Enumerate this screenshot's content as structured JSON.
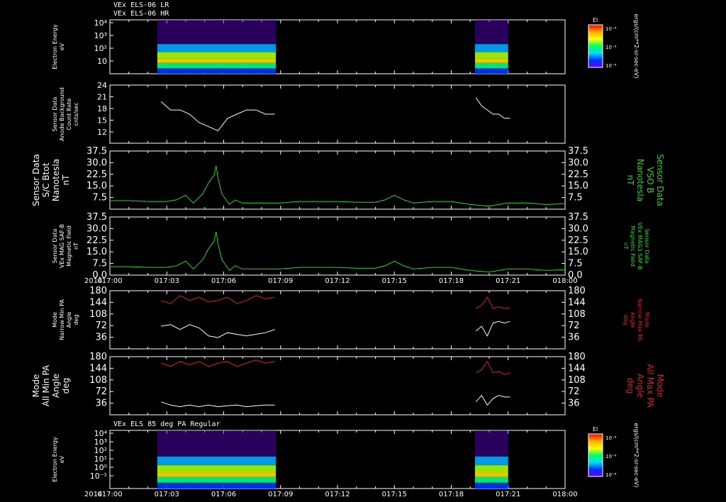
{
  "header": {
    "line1": "VEx ELS-06 LR",
    "line2": "VEx ELS-06 HR",
    "panel7_title": "VEx ELS 85 deg PA Regular"
  },
  "colors": {
    "bg": "#000000",
    "axis": "#ffffff",
    "green": "#22dd22",
    "red": "#dd2222",
    "white": "#ffffff"
  },
  "time_axis": {
    "labels": [
      "017:00",
      "017:03",
      "017:06",
      "017:09",
      "017:12",
      "017:15",
      "017:18",
      "017:21",
      "018:00"
    ],
    "year_label": "2014"
  },
  "colorbar": {
    "title": "El",
    "unit_label": "ergs/(cm**2-sr-sec-eV)",
    "ticks": [
      "10⁻⁴",
      "10⁻⁶",
      "10⁻⁸"
    ]
  },
  "chart_data": [
    {
      "id": "p1",
      "type": "heatmap",
      "ylabel": [
        "Electron Energy",
        "eV"
      ],
      "yticks_left": [
        "10⁴",
        "10³",
        "10²",
        "10"
      ],
      "scale": "log",
      "coverage": [
        [
          "017:02:30",
          "017:08:45"
        ],
        [
          "017:19:15",
          "017:21:00"
        ]
      ]
    },
    {
      "id": "p2",
      "type": "line",
      "ylabel": [
        "Sensor Data",
        "Anode Background",
        "Count Rate",
        "cnts/sec"
      ],
      "ylim": [
        10,
        24
      ],
      "yticks_left": [
        "24",
        "21",
        "18",
        "15",
        "12"
      ],
      "series": [
        {
          "color": "white",
          "segments": [
            {
              "x": [
                2.7,
                3.2,
                3.7,
                4.2,
                4.7,
                5.2,
                5.7,
                6.2,
                6.7,
                7.2,
                7.7,
                8.2,
                8.7
              ],
              "y": [
                20,
                18,
                18,
                17,
                15,
                14,
                13,
                16,
                17,
                18,
                18,
                17,
                17
              ]
            },
            {
              "x": [
                19.3,
                19.6,
                19.9,
                20.2,
                20.5,
                20.8,
                21.1
              ],
              "y": [
                21,
                19,
                18,
                17,
                17,
                16,
                16
              ]
            }
          ]
        }
      ]
    },
    {
      "id": "p3",
      "type": "line",
      "ylabel": [
        "Sensor Data",
        "S/C Btot",
        "Nanotesla",
        "nT"
      ],
      "ylabel_right": [
        "Sensor Data",
        "VSO B",
        "Nanotesla",
        "nT"
      ],
      "ylim": [
        0,
        37.5
      ],
      "yticks_left": [
        "37.5",
        "30.0",
        "22.5",
        "15.0",
        "7.5"
      ],
      "yticks_right": [
        "37.5",
        "30.0",
        "22.5",
        "15.0",
        "7.5"
      ],
      "series": [
        {
          "color": "green",
          "x": [
            0,
            1,
            2,
            3,
            3.5,
            4,
            4.4,
            4.9,
            5.2,
            5.5,
            5.6,
            5.7,
            5.9,
            6.3,
            6.6,
            7,
            8,
            9,
            10,
            11,
            12,
            13,
            14,
            14.5,
            15,
            15.5,
            16,
            17,
            18,
            19,
            20,
            21,
            22,
            23,
            24
          ],
          "y": [
            5.5,
            5.5,
            5,
            5,
            6,
            9,
            4,
            10,
            17,
            22,
            28,
            20,
            10,
            3,
            6,
            4,
            4,
            4,
            5,
            5,
            5,
            4.5,
            4.5,
            6,
            9,
            6,
            4,
            5,
            5,
            3,
            2,
            4,
            4,
            3,
            3.5
          ]
        }
      ]
    },
    {
      "id": "p4",
      "type": "line",
      "ylabel": [
        "Sensor Data",
        "VEx MAG SAF-B",
        "Magnetic Field",
        "nT"
      ],
      "ylabel_right": [
        "Sensor Data",
        "VEx MAG3 SAF-B",
        "Magnetic Field",
        "nT"
      ],
      "ylim": [
        0,
        37.5
      ],
      "yticks_left": [
        "37.5",
        "30.0",
        "22.5",
        "15.0",
        "7.5",
        "0.0"
      ],
      "yticks_right": [
        "37.5",
        "30.0",
        "22.5",
        "15.0",
        "7.5",
        "0.0"
      ],
      "series": [
        {
          "color": "green",
          "x": [
            0,
            1,
            2,
            3,
            3.5,
            4,
            4.4,
            4.9,
            5.2,
            5.5,
            5.6,
            5.7,
            5.9,
            6.3,
            6.6,
            7,
            8,
            9,
            10,
            11,
            12,
            13,
            14,
            14.5,
            15,
            15.5,
            16,
            17,
            18,
            19,
            20,
            21,
            22,
            23,
            24
          ],
          "y": [
            5.5,
            5.5,
            5,
            5,
            6,
            9,
            4,
            10,
            17,
            22,
            28,
            20,
            10,
            3,
            6,
            4,
            4,
            4,
            5,
            5,
            5,
            4.5,
            4.5,
            6,
            9,
            6,
            4,
            5,
            5,
            3,
            2,
            4,
            4,
            3,
            3.5
          ]
        }
      ]
    },
    {
      "id": "p5",
      "type": "line",
      "ylabel": [
        "Mode",
        "Narrow Min PA",
        "Angle",
        "deg"
      ],
      "ylabel_right": [
        "Mode",
        "Narrow Max PA",
        "Angle",
        "deg"
      ],
      "ylim": [
        0,
        180
      ],
      "yticks_left": [
        "180",
        "144",
        "108",
        "72",
        "36"
      ],
      "yticks_right": [
        "180",
        "144",
        "108",
        "72",
        "36"
      ],
      "series": [
        {
          "name": "Max PA",
          "color": "red",
          "segments": [
            {
              "x": [
                2.7,
                3.2,
                3.7,
                4.2,
                4.7,
                5.2,
                5.7,
                6.2,
                6.7,
                7.2,
                7.7,
                8.2,
                8.7
              ],
              "y": [
                150,
                140,
                165,
                150,
                160,
                145,
                150,
                160,
                140,
                150,
                165,
                155,
                160
              ]
            },
            {
              "x": [
                19.3,
                19.6,
                19.9,
                20.2,
                20.5,
                20.8,
                21.1
              ],
              "y": [
                125,
                135,
                160,
                125,
                130,
                125,
                128
              ]
            }
          ]
        },
        {
          "name": "Min PA",
          "color": "white",
          "segments": [
            {
              "x": [
                2.7,
                3.2,
                3.7,
                4.2,
                4.7,
                5.2,
                5.7,
                6.2,
                6.7,
                7.2,
                7.7,
                8.2,
                8.7
              ],
              "y": [
                70,
                75,
                60,
                75,
                65,
                40,
                35,
                50,
                45,
                40,
                45,
                50,
                60
              ]
            },
            {
              "x": [
                19.3,
                19.6,
                19.9,
                20.2,
                20.5,
                20.8,
                21.1
              ],
              "y": [
                55,
                70,
                40,
                80,
                85,
                80,
                85
              ]
            }
          ]
        }
      ]
    },
    {
      "id": "p6",
      "type": "line",
      "ylabel": [
        "Mode",
        "All Min PA",
        "Angle",
        "deg"
      ],
      "ylabel_right": [
        "Mode",
        "All Max PA",
        "Angle",
        "deg"
      ],
      "ylim": [
        0,
        180
      ],
      "yticks_left": [
        "180",
        "144",
        "108",
        "72",
        "36"
      ],
      "yticks_right": [
        "180",
        "144",
        "108",
        "72",
        "36"
      ],
      "series": [
        {
          "name": "Max PA",
          "color": "red",
          "segments": [
            {
              "x": [
                2.7,
                3.2,
                3.7,
                4.2,
                4.7,
                5.2,
                5.7,
                6.2,
                6.7,
                7.2,
                7.7,
                8.2,
                8.7
              ],
              "y": [
                160,
                150,
                165,
                155,
                165,
                150,
                160,
                165,
                150,
                160,
                170,
                160,
                165
              ]
            },
            {
              "x": [
                19.3,
                19.6,
                19.9,
                20.2,
                20.5,
                20.8,
                21.1
              ],
              "y": [
                130,
                140,
                165,
                130,
                135,
                125,
                130
              ]
            }
          ]
        },
        {
          "name": "Min PA",
          "color": "white",
          "segments": [
            {
              "x": [
                2.7,
                3.2,
                3.7,
                4.2,
                4.7,
                5.2,
                5.7,
                6.2,
                6.7,
                7.2,
                7.7,
                8.2,
                8.7
              ],
              "y": [
                40,
                30,
                25,
                30,
                25,
                30,
                25,
                28,
                30,
                25,
                28,
                30,
                30
              ]
            },
            {
              "x": [
                19.3,
                19.6,
                19.9,
                20.2,
                20.5,
                20.8,
                21.1
              ],
              "y": [
                40,
                60,
                30,
                50,
                60,
                55,
                55
              ]
            }
          ]
        }
      ]
    },
    {
      "id": "p7",
      "type": "heatmap",
      "ylabel": [
        "Electron Energy",
        "eV"
      ],
      "yticks_left": [
        "10⁴",
        "10³",
        "10²",
        "10¹",
        "10⁰",
        "10⁻¹"
      ],
      "scale": "log",
      "coverage": [
        [
          "017:02:30",
          "017:08:45"
        ],
        [
          "017:19:15",
          "017:21:00"
        ]
      ]
    }
  ]
}
